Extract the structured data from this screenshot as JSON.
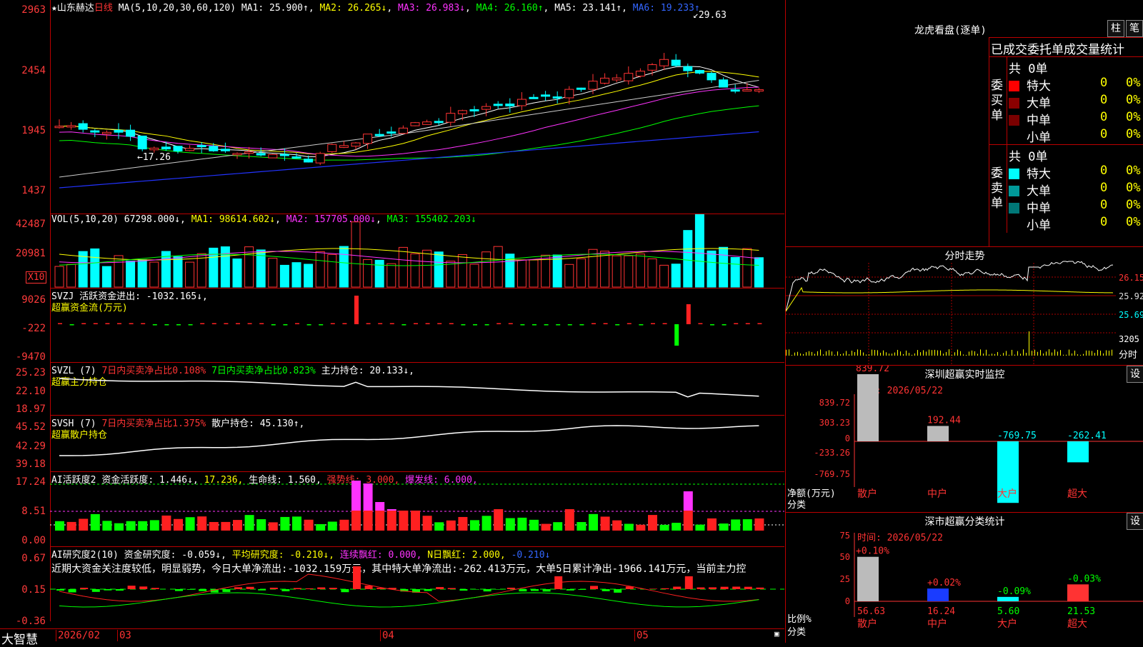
{
  "stock": {
    "star": "★",
    "name": "山东赫达",
    "period": "日线"
  },
  "main_ma": {
    "label": "MA(5,10,20,30,60,120)",
    "ma1": "MA1: 25.900↑",
    "ma2": "MA2: 26.265↓",
    "ma3": "MA3: 26.983↓",
    "ma4": "MA4: 26.160↑",
    "ma5": "MA5: 23.141↑",
    "ma6": "MA6: 19.233↑"
  },
  "main_ticks": [
    "2963",
    "2454",
    "1945",
    "1437"
  ],
  "main_annotations": {
    "high": "29.63",
    "low": "17.26"
  },
  "vol": {
    "label": "VOL(5,10,20)",
    "value": "67298.000↓",
    "ma1": "MA1: 98614.602↓",
    "ma2": "MA2: 157705.000↓",
    "ma3": "MA3: 155402.203↓",
    "ticks": [
      "42487",
      "20981"
    ],
    "unit": "X10"
  },
  "svzj": {
    "label": "SVZJ",
    "title": "活跃资金进出: -1032.165↓,",
    "sub": "超赢资金流(万元)",
    "ticks": [
      "9026",
      "-222",
      "-9470"
    ]
  },
  "svzl": {
    "label": "SVZL (7)",
    "t1": "7日内买卖净占比0.108%",
    "t2": "7日内买卖净占比0.823%",
    "t3": "主力持仓: 20.133↓,",
    "sub": "超赢主力持仓",
    "ticks": [
      "25.23",
      "22.10",
      "18.97"
    ]
  },
  "svsh": {
    "label": "SVSH (7)",
    "t1": "7日内买卖净占比1.375%",
    "t2": "散户持仓: 45.130↑,",
    "sub": "超赢散户持仓",
    "ticks": [
      "45.52",
      "42.29",
      "39.18"
    ]
  },
  "ai_act": {
    "label": "AI活跃度2",
    "t1": "资金活跃度: 1.446↓,",
    "t2": "17.236,",
    "t3": "生命线: 1.560,",
    "t4": "强势线: 3.000,",
    "t5": "爆发线: 6.000,",
    "ticks": [
      "17.24",
      "8.51",
      "0.00"
    ]
  },
  "ai_res": {
    "label": "AI研究度2(10)",
    "t1": "资金研究度: -0.059↓,",
    "t2": "平均研究度: -0.210↓,",
    "t3": "连续飘红: 0.000,",
    "t4": "N日飘红: 2.000,",
    "t5": "-0.210↓",
    "comment": "近期大资金关注度较低，明显弱势，今日大单净流出:-1032.159万元，其中特大单净流出:-262.413万元，大单5日累计净出-1966.141万元，当前主力控",
    "ticks": [
      "0.67",
      "0.15",
      "-0.36"
    ]
  },
  "xaxis": {
    "brand": "大智慧",
    "labels": [
      "2026/02",
      "03",
      "04",
      "05"
    ]
  },
  "dragon": {
    "title": "龙虎看盘(逐单)",
    "btn1": "柱",
    "btn2": "笔",
    "subtitle": "已成交委托单成交量统计",
    "buy": {
      "side": "委买单",
      "total": "共 0单",
      "rows": [
        {
          "name": "特大",
          "v": "0",
          "p": "0%",
          "color": "#ff0000"
        },
        {
          "name": "大单",
          "v": "0",
          "p": "0%",
          "color": "#8b0000"
        },
        {
          "name": "中单",
          "v": "0",
          "p": "0%",
          "color": "#7a0000"
        },
        {
          "name": "小单",
          "v": "0",
          "p": "0%",
          "color": "#000000"
        }
      ]
    },
    "sell": {
      "side": "委卖单",
      "total": "共 0单",
      "rows": [
        {
          "name": "特大",
          "v": "0",
          "p": "0%",
          "color": "#00ffff"
        },
        {
          "name": "大单",
          "v": "0",
          "p": "0%",
          "color": "#009999"
        },
        {
          "name": "中单",
          "v": "0",
          "p": "0%",
          "color": "#007777"
        },
        {
          "name": "小单",
          "v": "0",
          "p": "0%",
          "color": "#000000"
        }
      ]
    }
  },
  "intraday": {
    "title": "分时走势",
    "ticks": [
      "26.15",
      "25.92",
      "25.69"
    ],
    "vol_tick": "3205",
    "vol_label": "分时"
  },
  "sz_monitor": {
    "title": "深圳超赢实时监控",
    "btn": "设",
    "time": "时间: 2026/05/22",
    "ylabel": "净额(万元)",
    "xlabel": "分类",
    "ticks": [
      "839.72",
      "303.23",
      "0",
      "-233.26",
      "-769.75"
    ],
    "chart_data": {
      "type": "bar",
      "categories": [
        "散户",
        "中户",
        "大户",
        "超大"
      ],
      "values": [
        839.72,
        192.44,
        -769.75,
        -262.41
      ],
      "ylim": [
        -769.75,
        839.72
      ],
      "labels": [
        "839.72",
        "192.44",
        "-769.75",
        "-262.41"
      ]
    }
  },
  "sz_class": {
    "title": "深市超赢分类统计",
    "btn": "设",
    "time": "时间: 2026/05/22",
    "ylabel": "比例%",
    "xlabel": "分类",
    "ticks": [
      "75",
      "50",
      "25",
      "0"
    ],
    "chart_data": {
      "type": "bar",
      "categories": [
        "散户",
        "中户",
        "大户",
        "超大"
      ],
      "values": [
        56.63,
        16.24,
        5.6,
        21.53
      ],
      "changes": [
        "+0.10%",
        "+0.02%",
        "-0.09%",
        "-0.03%"
      ],
      "ylim": [
        0,
        75
      ],
      "labels": [
        "56.63",
        "16.24",
        "5.60",
        "21.53"
      ]
    }
  }
}
